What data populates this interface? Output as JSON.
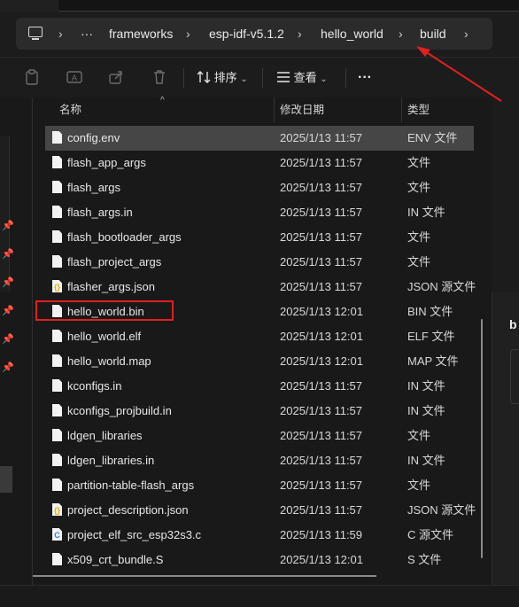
{
  "address_bar": {
    "more": "···",
    "crumbs": [
      "frameworks",
      "esp-idf-v5.1.2",
      "hello_world",
      "build"
    ]
  },
  "toolbar": {
    "sort_label": "排序",
    "view_label": "查看",
    "more_label": "···"
  },
  "columns": {
    "name": "名称",
    "date": "修改日期",
    "type": "类型"
  },
  "files": [
    {
      "name": "config.env",
      "date": "2025/1/13 11:57",
      "type": "ENV 文件",
      "icon": "file-icon",
      "selected": true
    },
    {
      "name": "flash_app_args",
      "date": "2025/1/13 11:57",
      "type": "文件",
      "icon": "file-icon"
    },
    {
      "name": "flash_args",
      "date": "2025/1/13 11:57",
      "type": "文件",
      "icon": "file-icon"
    },
    {
      "name": "flash_args.in",
      "date": "2025/1/13 11:57",
      "type": "IN 文件",
      "icon": "file-icon"
    },
    {
      "name": "flash_bootloader_args",
      "date": "2025/1/13 11:57",
      "type": "文件",
      "icon": "file-icon"
    },
    {
      "name": "flash_project_args",
      "date": "2025/1/13 11:57",
      "type": "文件",
      "icon": "file-icon"
    },
    {
      "name": "flasher_args.json",
      "date": "2025/1/13 11:57",
      "type": "JSON 源文件",
      "icon": "json-file-icon"
    },
    {
      "name": "hello_world.bin",
      "date": "2025/1/13 12:01",
      "type": "BIN 文件",
      "icon": "file-icon"
    },
    {
      "name": "hello_world.elf",
      "date": "2025/1/13 12:01",
      "type": "ELF 文件",
      "icon": "file-icon"
    },
    {
      "name": "hello_world.map",
      "date": "2025/1/13 12:01",
      "type": "MAP 文件",
      "icon": "file-icon"
    },
    {
      "name": "kconfigs.in",
      "date": "2025/1/13 11:57",
      "type": "IN 文件",
      "icon": "file-icon"
    },
    {
      "name": "kconfigs_projbuild.in",
      "date": "2025/1/13 11:57",
      "type": "IN 文件",
      "icon": "file-icon"
    },
    {
      "name": "ldgen_libraries",
      "date": "2025/1/13 11:57",
      "type": "文件",
      "icon": "file-icon"
    },
    {
      "name": "ldgen_libraries.in",
      "date": "2025/1/13 11:57",
      "type": "IN 文件",
      "icon": "file-icon"
    },
    {
      "name": "partition-table-flash_args",
      "date": "2025/1/13 11:57",
      "type": "文件",
      "icon": "file-icon"
    },
    {
      "name": "project_description.json",
      "date": "2025/1/13 11:57",
      "type": "JSON 源文件",
      "icon": "json-file-icon"
    },
    {
      "name": "project_elf_src_esp32s3.c",
      "date": "2025/1/13 11:59",
      "type": "C 源文件",
      "icon": "c-file-icon"
    },
    {
      "name": "x509_crt_bundle.S",
      "date": "2025/1/13 12:01",
      "type": "S 文件",
      "icon": "file-icon"
    }
  ],
  "right_pane": {
    "peek_text": "b"
  },
  "annotation": {
    "color": "#e02020"
  }
}
